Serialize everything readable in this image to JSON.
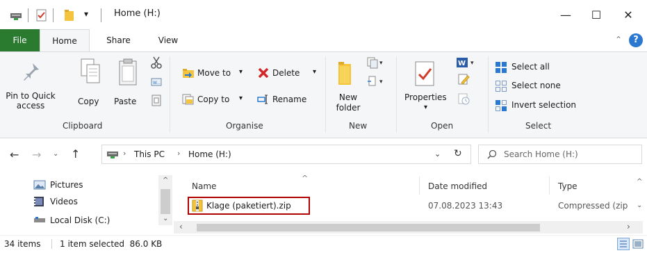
{
  "window": {
    "title": "Home (H:)",
    "minimize": "—",
    "maximize": "☐",
    "close": "✕"
  },
  "tabs": {
    "file": "File",
    "home": "Home",
    "share": "Share",
    "view": "View"
  },
  "ribbon": {
    "clipboard": {
      "label": "Clipboard",
      "pin_line1": "Pin to Quick",
      "pin_line2": "access",
      "copy": "Copy",
      "paste": "Paste"
    },
    "organise": {
      "label": "Organise",
      "move_to": "Move to",
      "copy_to": "Copy to",
      "delete": "Delete",
      "rename": "Rename"
    },
    "new": {
      "label": "New",
      "new_folder_line1": "New",
      "new_folder_line2": "folder"
    },
    "open": {
      "label": "Open",
      "properties": "Properties"
    },
    "select": {
      "label": "Select",
      "select_all": "Select all",
      "select_none": "Select none",
      "invert_selection": "Invert selection"
    }
  },
  "address": {
    "this_pc": "This PC",
    "current": "Home (H:)",
    "search_placeholder": "Search Home (H:)"
  },
  "nav": {
    "items": [
      "Pictures",
      "Videos",
      "Local Disk (C:)"
    ]
  },
  "list": {
    "columns": [
      "Name",
      "Date modified",
      "Type"
    ],
    "rows": [
      {
        "name": "Klage (paketiert).zip",
        "date": "07.08.2023 13:43",
        "type": "Compressed (zip"
      }
    ]
  },
  "status": {
    "items": "34 items",
    "selected": "1 item selected  86.0 KB"
  },
  "colors": {
    "file_tab": "#2a7a2f",
    "highlight_box": "#b00000",
    "folder": "#f4c43c",
    "accent_blue": "#2b78d0"
  }
}
